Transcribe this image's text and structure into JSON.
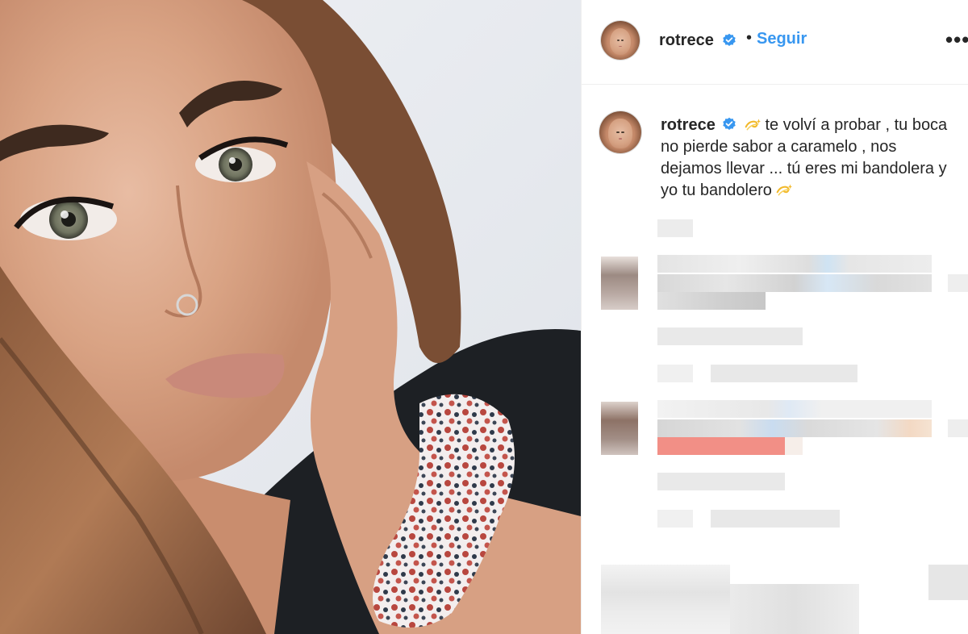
{
  "post": {
    "username": "rotrece",
    "separator": "•",
    "follow_label": "Seguir",
    "more_label": "•••"
  },
  "caption": {
    "username": "rotrece",
    "line1": "te volví a probar , tu boca",
    "line2": "no pierde sabor a caramelo , nos",
    "line3": "dejamos llevar ... tú eres mi bandolera y",
    "line4": "yo tu bandolero"
  },
  "icons": {
    "verified": "verified-badge-icon",
    "sparkle": "dizzy-sparkle-emoji",
    "more": "more-options-icon"
  },
  "colors": {
    "accent": "#3897f0",
    "verified": "#3897f0",
    "text": "#262626",
    "divider": "#efefef"
  }
}
